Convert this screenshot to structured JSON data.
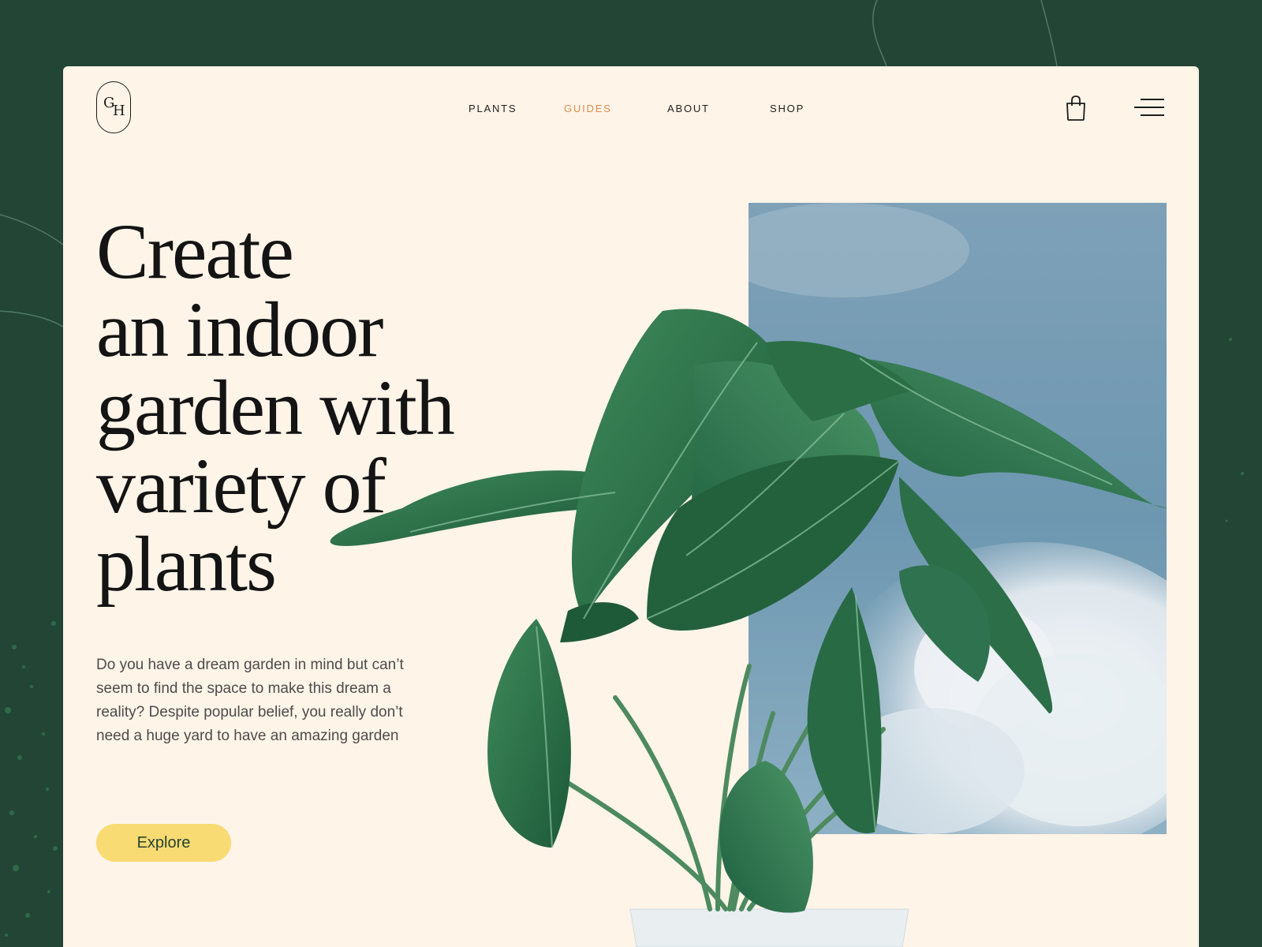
{
  "logo": {
    "letter_1": "G",
    "letter_2": "H"
  },
  "nav": {
    "items": [
      {
        "label": "PLANTS",
        "active": false
      },
      {
        "label": "GUIDES",
        "active": true
      },
      {
        "label": "ABOUT",
        "active": false
      },
      {
        "label": "SHOP",
        "active": false
      }
    ]
  },
  "header_icons": [
    "shopping-bag-icon",
    "hamburger-menu-icon"
  ],
  "hero": {
    "title_lines": [
      "Create",
      "an indoor",
      "garden with",
      "variety of",
      "plants"
    ],
    "description": "Do you have a dream garden in mind but can’t seem to find the space to make this dream a reality? Despite popular belief, you really don’t need a huge yard to have an amazing garden",
    "cta_label": "Explore"
  },
  "colors": {
    "background": "#234536",
    "card": "#fff4e8",
    "accent_nav": "#e38b4f",
    "button": "#f8db72",
    "title": "#141414"
  }
}
